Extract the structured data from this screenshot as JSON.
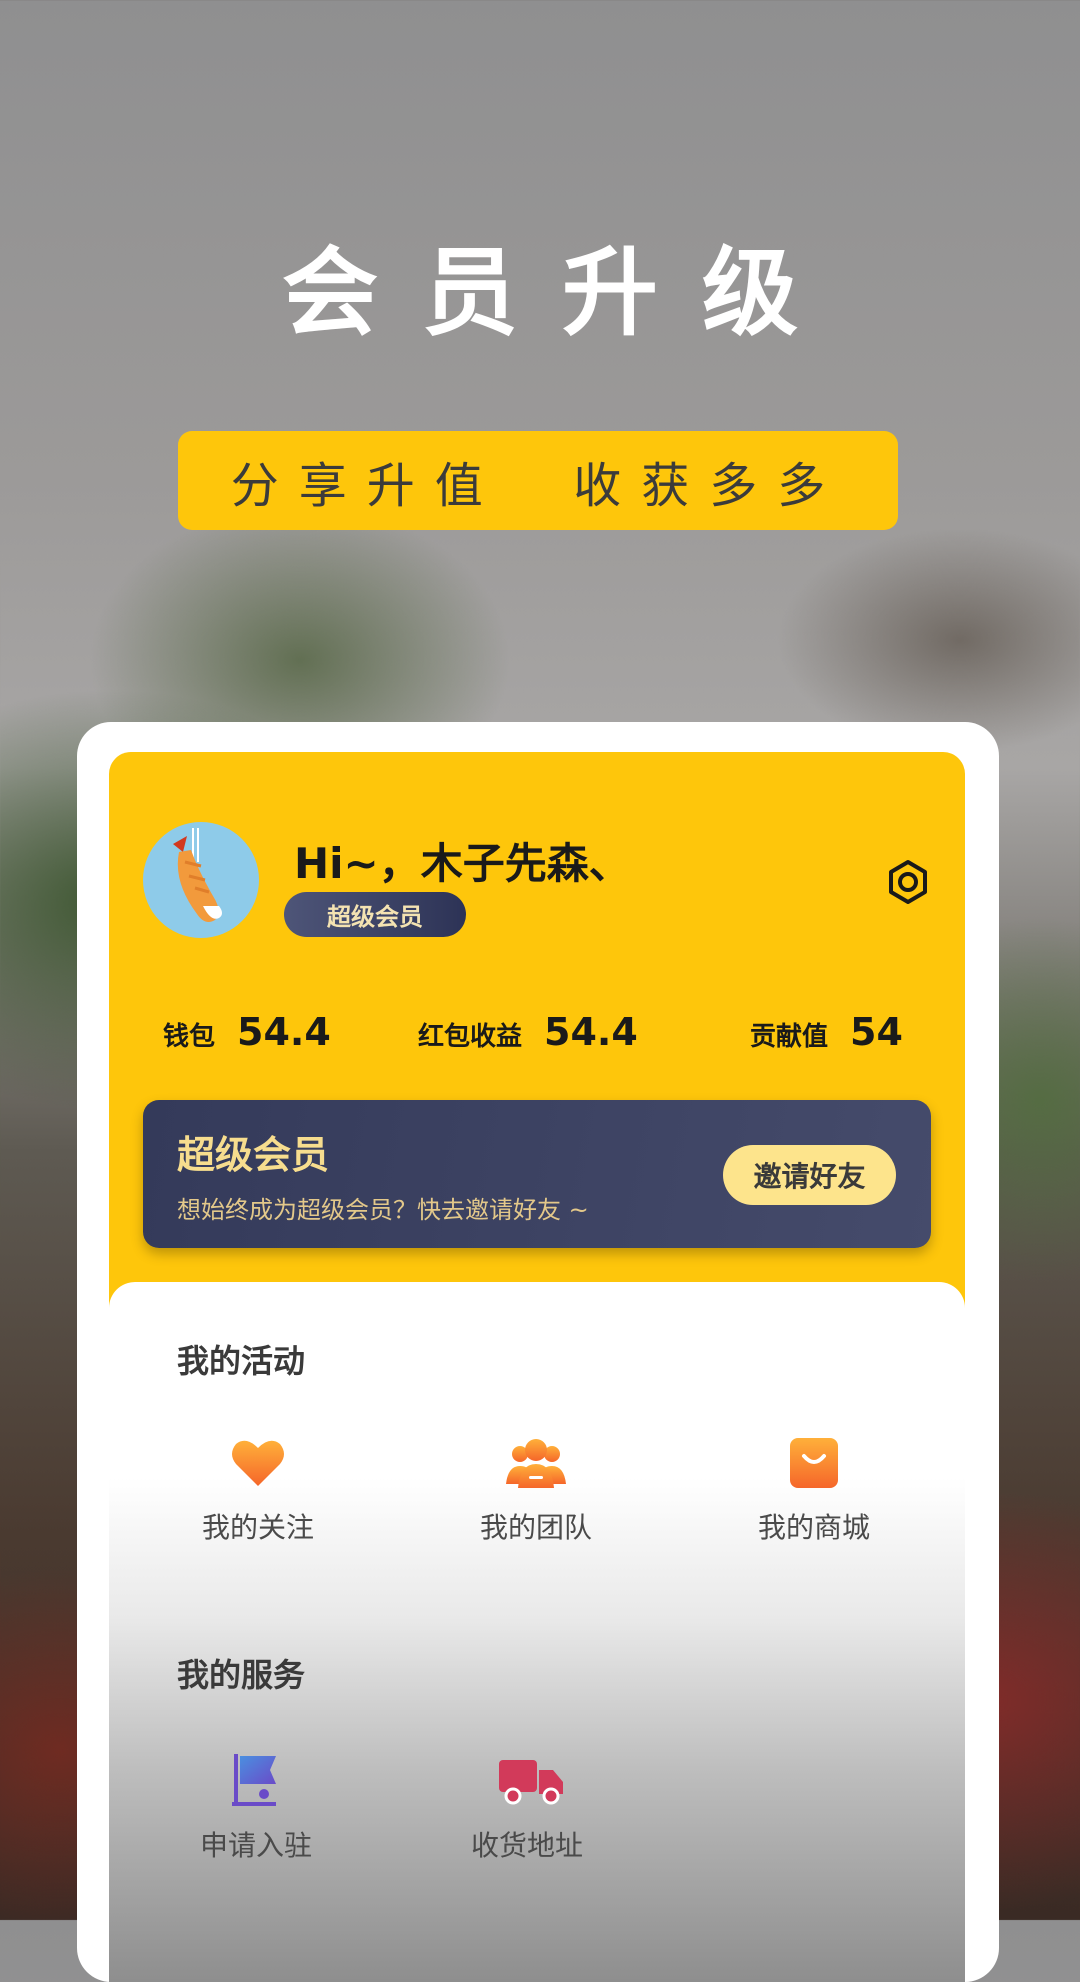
{
  "hero": {
    "title": "会员升级",
    "slogan": "分享升值  收获多多"
  },
  "profile": {
    "greeting": "Hi~，木子先森、",
    "badge": "超级会员"
  },
  "stats": [
    {
      "label": "钱包",
      "value": "54.4"
    },
    {
      "label": "红包收益",
      "value": "54.4"
    },
    {
      "label": "贡献值",
      "value": "54"
    }
  ],
  "vip_banner": {
    "title": "超级会员",
    "subtitle": "想始终成为超级会员？快去邀请好友 ~",
    "button": "邀请好友"
  },
  "activities": {
    "title": "我的活动",
    "items": [
      {
        "label": "我的关注",
        "icon": "heart-icon"
      },
      {
        "label": "我的团队",
        "icon": "team-icon"
      },
      {
        "label": "我的商城",
        "icon": "shopping-bag-icon"
      }
    ]
  },
  "services": {
    "title": "我的服务",
    "items": [
      {
        "label": "申请入驻",
        "icon": "flag-icon"
      },
      {
        "label": "收货地址",
        "icon": "truck-icon"
      }
    ]
  },
  "colors": {
    "accent_yellow": "#fec60b",
    "banner_navy": "#343a5a",
    "icon_orange": "#f56a2a"
  }
}
